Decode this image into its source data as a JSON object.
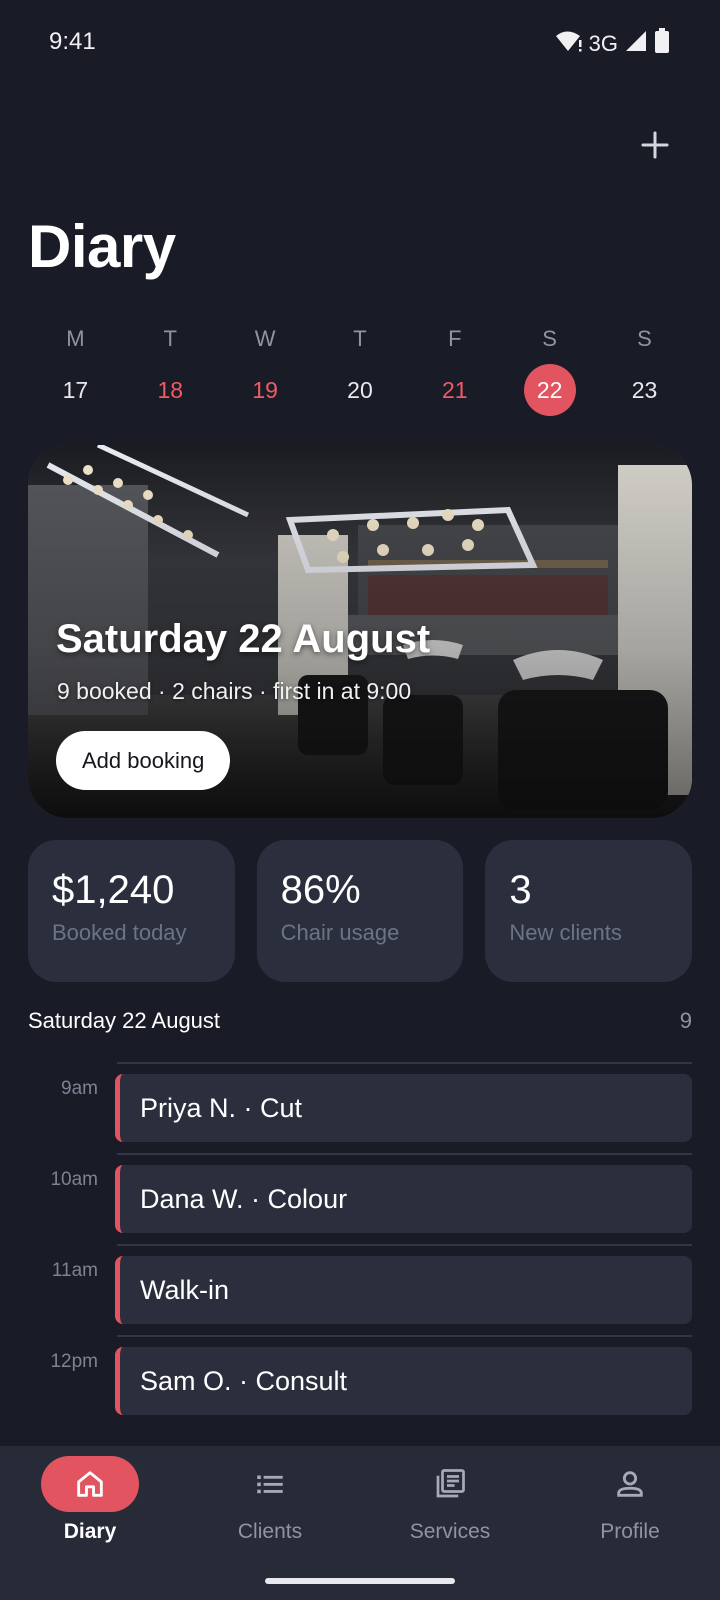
{
  "status_bar": {
    "time": "9:41",
    "network": "3G"
  },
  "header": {
    "title": "Diary",
    "add_icon": "plus-icon"
  },
  "week": {
    "days": [
      {
        "letter": "M",
        "date": "17",
        "state": "normal"
      },
      {
        "letter": "T",
        "date": "18",
        "state": "marked"
      },
      {
        "letter": "W",
        "date": "19",
        "state": "marked"
      },
      {
        "letter": "T",
        "date": "20",
        "state": "normal"
      },
      {
        "letter": "F",
        "date": "21",
        "state": "marked"
      },
      {
        "letter": "S",
        "date": "22",
        "state": "selected"
      },
      {
        "letter": "S",
        "date": "23",
        "state": "normal"
      }
    ]
  },
  "hero": {
    "title": "Saturday 22 August",
    "subtitle": "9 booked · 2 chairs · first in at 9:00",
    "button_label": "Add booking"
  },
  "stats": [
    {
      "value": "$1,240",
      "label": "Booked today"
    },
    {
      "value": "86%",
      "label": "Chair usage"
    },
    {
      "value": "3",
      "label": "New clients"
    }
  ],
  "schedule": {
    "title": "Saturday 22 August",
    "count": "9",
    "slots": [
      {
        "time": "9am",
        "booking": "Priya N. · Cut"
      },
      {
        "time": "10am",
        "booking": "Dana W. · Colour"
      },
      {
        "time": "11am",
        "booking": "Walk-in"
      },
      {
        "time": "12pm",
        "booking": "Sam O. · Consult"
      }
    ]
  },
  "nav": {
    "items": [
      {
        "label": "Diary",
        "icon": "home-icon",
        "active": true
      },
      {
        "label": "Clients",
        "icon": "list-icon",
        "active": false
      },
      {
        "label": "Services",
        "icon": "library-icon",
        "active": false
      },
      {
        "label": "Profile",
        "icon": "person-icon",
        "active": false
      }
    ]
  },
  "colors": {
    "background": "#191b26",
    "accent": "#e25560",
    "card": "#2b2f3d",
    "nav": "#272a37"
  }
}
